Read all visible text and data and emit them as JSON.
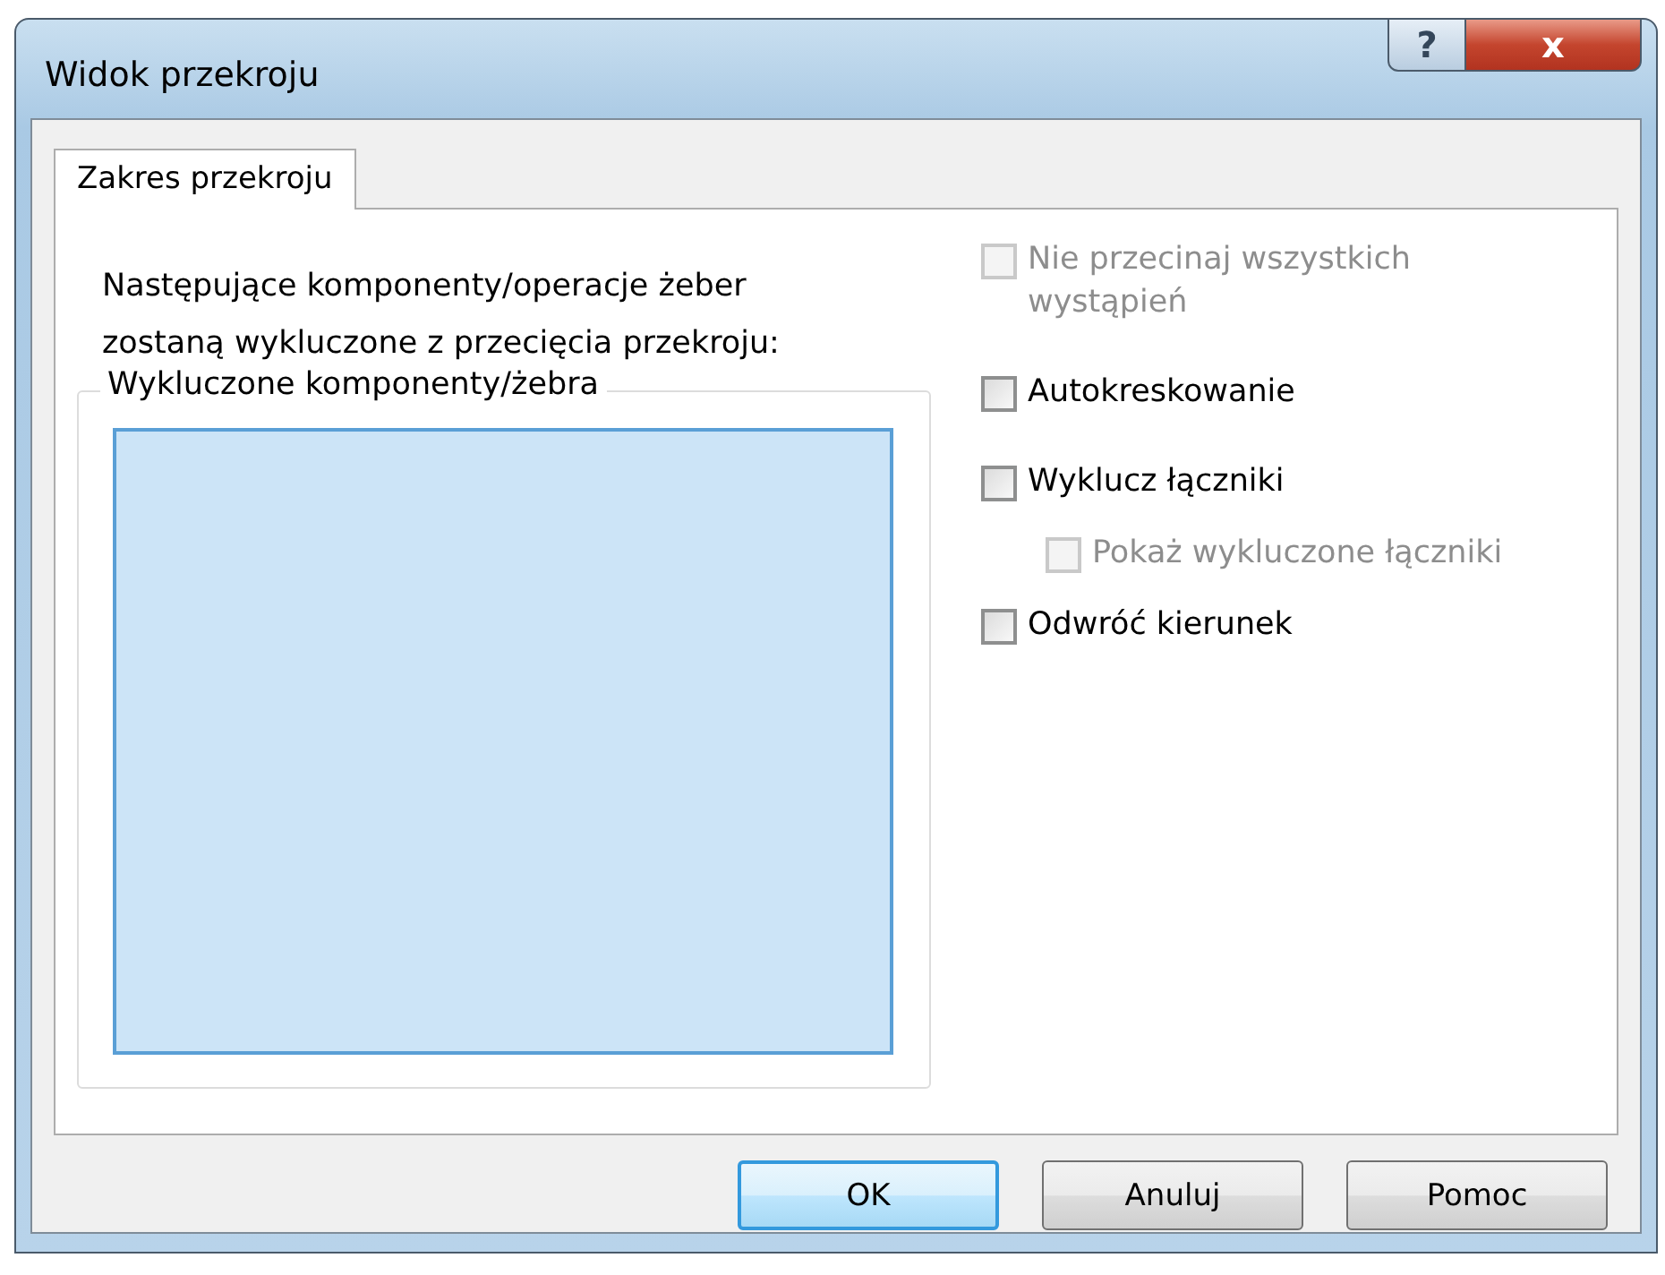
{
  "window": {
    "title": "Widok przekroju",
    "controls": [
      {
        "kind": "help",
        "label": "?"
      },
      {
        "kind": "close",
        "label": "x"
      }
    ]
  },
  "tabs": [
    {
      "label": "Zakres przekroju",
      "selected": true
    }
  ],
  "description": [
    "Następujące komponenty/operacje żeber",
    "zostaną wykluczone z przecięcia przekroju:"
  ],
  "excluded_group": {
    "legend": "Wykluczone komponenty/żebra",
    "list_focused": true
  },
  "options": [
    {
      "label": "Nie przecinaj wszystkich wystąpień",
      "checked": false,
      "disabled": true
    },
    {
      "label": "Autokreskowanie",
      "checked": false,
      "disabled": false
    },
    {
      "label": "Wyklucz łączniki",
      "checked": false,
      "disabled": false,
      "children": [
        {
          "label": "Pokaż wykluczone łączniki",
          "checked": false,
          "disabled": true
        }
      ]
    },
    {
      "label": "Odwróć kierunek",
      "checked": false,
      "disabled": false
    }
  ],
  "buttons": [
    {
      "label": "OK",
      "default": true
    },
    {
      "label": "Anuluj",
      "default": false
    },
    {
      "label": "Pomoc",
      "default": false
    }
  ]
}
